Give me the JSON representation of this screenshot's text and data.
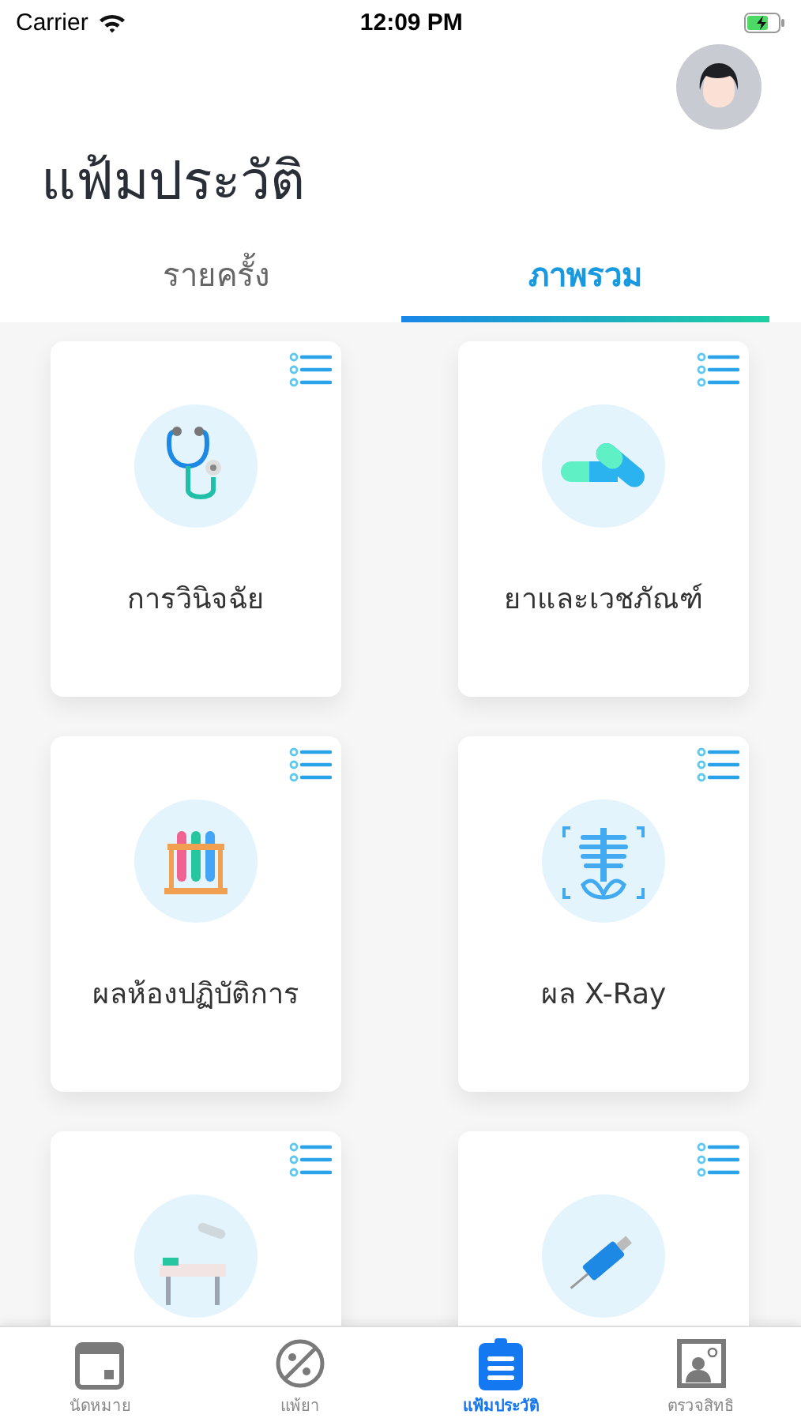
{
  "status_bar": {
    "carrier": "Carrier",
    "time": "12:09 PM"
  },
  "title": "แฟ้มประวัติ",
  "tabs": [
    {
      "label": "รายครั้ง",
      "selected": false
    },
    {
      "label": "ภาพรวม",
      "selected": true
    }
  ],
  "cards": [
    {
      "kind": "stethoscope",
      "label": "การวินิจฉัย"
    },
    {
      "kind": "pills",
      "label": "ยาและเวชภัณฑ์"
    },
    {
      "kind": "test-tubes",
      "label": "ผลห้องปฏิบัติการ"
    },
    {
      "kind": "xray",
      "label": "ผล X-Ray"
    },
    {
      "kind": "bed"
    },
    {
      "kind": "syringe"
    }
  ],
  "bottom_tabs": [
    {
      "kind": "calendar",
      "label": "นัดหมาย",
      "selected": false
    },
    {
      "kind": "no-allergy",
      "label": "แพ้ยา",
      "selected": false
    },
    {
      "kind": "clipboard",
      "label": "แฟ้มประวัติ",
      "selected": true
    },
    {
      "kind": "id-card",
      "label": "ตรวจสิทธิ",
      "selected": false
    }
  ]
}
